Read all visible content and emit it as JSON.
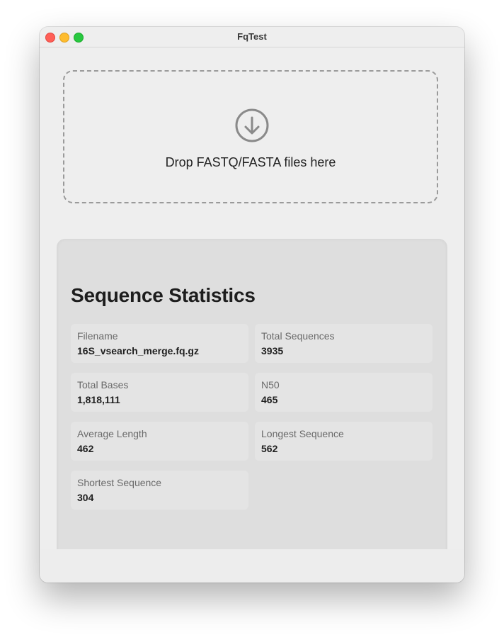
{
  "window": {
    "title": "FqTest"
  },
  "dropzone": {
    "icon": "arrow-down-circle-icon",
    "label": "Drop FASTQ/FASTA files here"
  },
  "stats": {
    "title": "Sequence Statistics",
    "items": [
      {
        "label": "Filename",
        "value": "16S_vsearch_merge.fq.gz"
      },
      {
        "label": "Total Sequences",
        "value": "3935"
      },
      {
        "label": "Total Bases",
        "value": "1,818,111"
      },
      {
        "label": "N50",
        "value": "465"
      },
      {
        "label": "Average Length",
        "value": "462"
      },
      {
        "label": "Longest Sequence",
        "value": "562"
      },
      {
        "label": "Shortest Sequence",
        "value": "304"
      }
    ]
  },
  "colors": {
    "close": "#ff5f57",
    "minimize": "#febc2e",
    "zoom": "#28c840"
  }
}
